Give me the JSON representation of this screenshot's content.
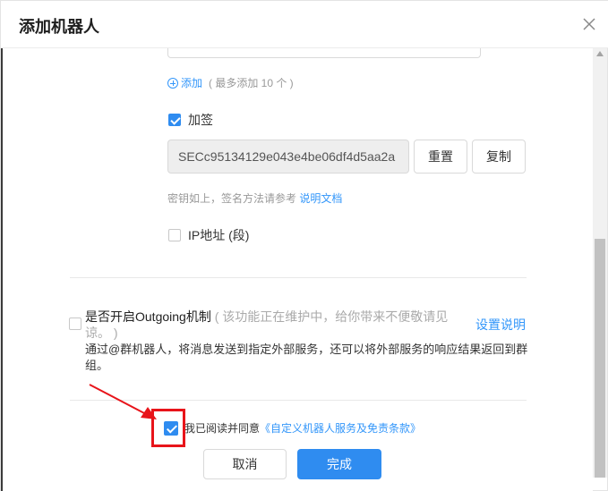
{
  "dialog": {
    "title": "添加机器人"
  },
  "add_link": {
    "label": "添加",
    "hint": "( 最多添加 10 个 )"
  },
  "sign": {
    "label": "加签",
    "checked": true,
    "secret_value": "SECc95134129e043e4be06df4d5aa2a",
    "reset_label": "重置",
    "copy_label": "复制",
    "hint_prefix": "密钥如上，签名方法请参考",
    "hint_link": "说明文档"
  },
  "ip": {
    "label": "IP地址 (段)",
    "checked": false
  },
  "outgoing": {
    "title": "是否开启Outgoing机制",
    "note": "( 该功能正在维护中，给你带来不便敬请见谅。 )",
    "setup_link": "设置说明",
    "description": "通过@群机器人，将消息发送到指定外部服务，还可以将外部服务的响应结果返回到群组。"
  },
  "agreement": {
    "prefix": "我已阅读并同意",
    "link": "《自定义机器人服务及免责条款》",
    "checked": true
  },
  "footer": {
    "cancel_label": "取消",
    "done_label": "完成"
  },
  "colors": {
    "accent": "#2f8cf0",
    "link": "#3296fa",
    "highlight": "#e8141a"
  },
  "icons": [
    "close-icon",
    "add-circle-icon",
    "check-icon",
    "arrow-annotation"
  ]
}
